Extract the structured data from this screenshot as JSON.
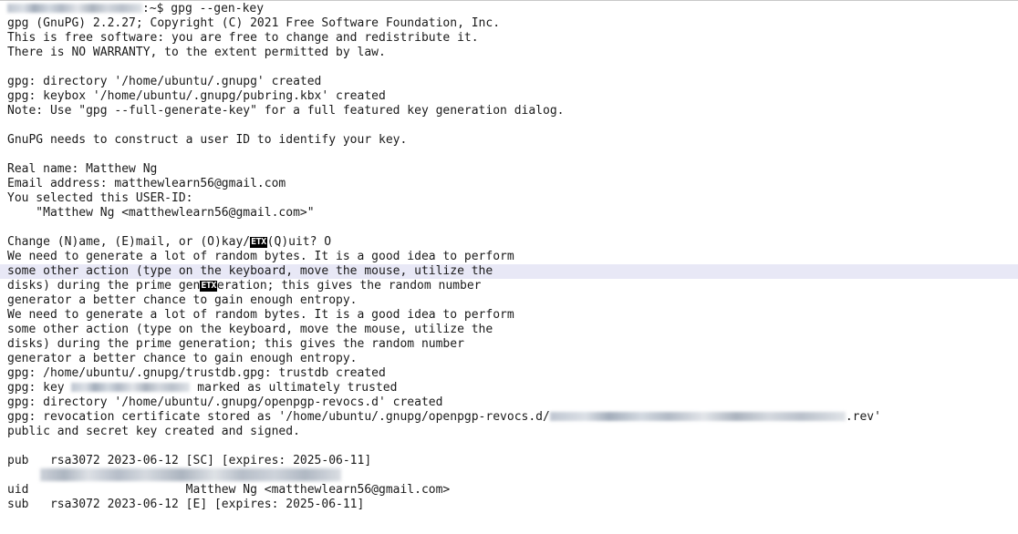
{
  "prompt": {
    "suffix": ":~$ gpg --gen-key"
  },
  "lines": {
    "l1": "gpg (GnuPG) 2.2.27; Copyright (C) 2021 Free Software Foundation, Inc.",
    "l2": "This is free software: you are free to change and redistribute it.",
    "l3": "There is NO WARRANTY, to the extent permitted by law.",
    "l5": "gpg: directory '/home/ubuntu/.gnupg' created",
    "l6": "gpg: keybox '/home/ubuntu/.gnupg/pubring.kbx' created",
    "l7": "Note: Use \"gpg --full-generate-key\" for a full featured key generation dialog.",
    "l9": "GnuPG needs to construct a user ID to identify your key.",
    "l11": "Real name: Matthew Ng",
    "l12": "Email address: matthewlearn56@gmail.com",
    "l13": "You selected this USER-ID:",
    "l14": "    \"Matthew Ng <matthewlearn56@gmail.com>\"",
    "l16a": "Change (N)ame, (E)mail, or (O)kay/",
    "l16ctrl": "ETX",
    "l16b": "(Q)uit? O",
    "l17": "We need to generate a lot of random bytes. It is a good idea to perform",
    "l18": "some other action (type on the keyboard, move the mouse, utilize the",
    "l19a": "disks) during the prime gen",
    "l19ctrl": "ETX",
    "l19b": "eration; this gives the random number",
    "l20": "generator a better chance to gain enough entropy.",
    "l21": "We need to generate a lot of random bytes. It is a good idea to perform",
    "l22": "some other action (type on the keyboard, move the mouse, utilize the",
    "l23": "disks) during the prime generation; this gives the random number",
    "l24": "generator a better chance to gain enough entropy.",
    "l25": "gpg: /home/ubuntu/.gnupg/trustdb.gpg: trustdb created",
    "l26a": "gpg: key ",
    "l26b": " marked as ultimately trusted",
    "l27": "gpg: directory '/home/ubuntu/.gnupg/openpgp-revocs.d' created",
    "l28a": "gpg: revocation certificate stored as '/home/ubuntu/.gnupg/openpgp-revocs.d/",
    "l28b": ".rev'",
    "l29": "public and secret key created and signed.",
    "l31": "pub   rsa3072 2023-06-12 [SC] [expires: 2025-06-11]",
    "l33": "uid                      Matthew Ng <matthewlearn56@gmail.com>",
    "l34": "sub   rsa3072 2023-06-12 [E] [expires: 2025-06-11]"
  }
}
